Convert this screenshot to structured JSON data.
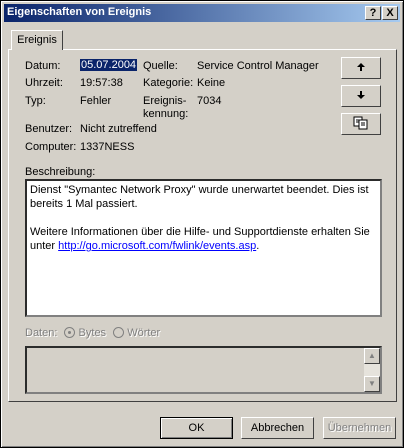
{
  "window": {
    "title": "Eigenschaften von Ereignis",
    "help_btn": "?",
    "close_btn": "X"
  },
  "tab": {
    "label": "Ereignis"
  },
  "fields": {
    "datum_label": "Datum:",
    "datum_value": "05.07.2004",
    "uhrzeit_label": "Uhrzeit:",
    "uhrzeit_value": "19:57:38",
    "typ_label": "Typ:",
    "typ_value": "Fehler",
    "benutzer_label": "Benutzer:",
    "benutzer_value": "Nicht zutreffend",
    "computer_label": "Computer:",
    "computer_value": "1337NESS",
    "quelle_label": "Quelle:",
    "quelle_value": "Service Control Manager",
    "kategorie_label": "Kategorie:",
    "kategorie_value": "Keine",
    "ereignis_label_1": "Ereignis-",
    "ereignis_label_2": "kennung:",
    "ereignis_value": "7034"
  },
  "side_buttons": {
    "up_icon": "arrow-up-icon",
    "down_icon": "arrow-down-icon",
    "copy_icon": "copy-icon"
  },
  "description": {
    "label": "Beschreibung:",
    "line1": "Dienst \"Symantec Network Proxy\" wurde unerwartet beendet. Dies ist bereits 1 Mal passiert.",
    "line2_text": "Weitere Informationen über die Hilfe- und Supportdienste erhalten Sie unter ",
    "line2_link": "http://go.microsoft.com/fwlink/events.asp",
    "line2_end": "."
  },
  "data": {
    "label": "Daten:",
    "radio_bytes": "Bytes",
    "radio_words": "Wörter",
    "selected": "Bytes"
  },
  "buttons": {
    "ok": "OK",
    "cancel": "Abbrechen",
    "apply": "Übernehmen"
  }
}
